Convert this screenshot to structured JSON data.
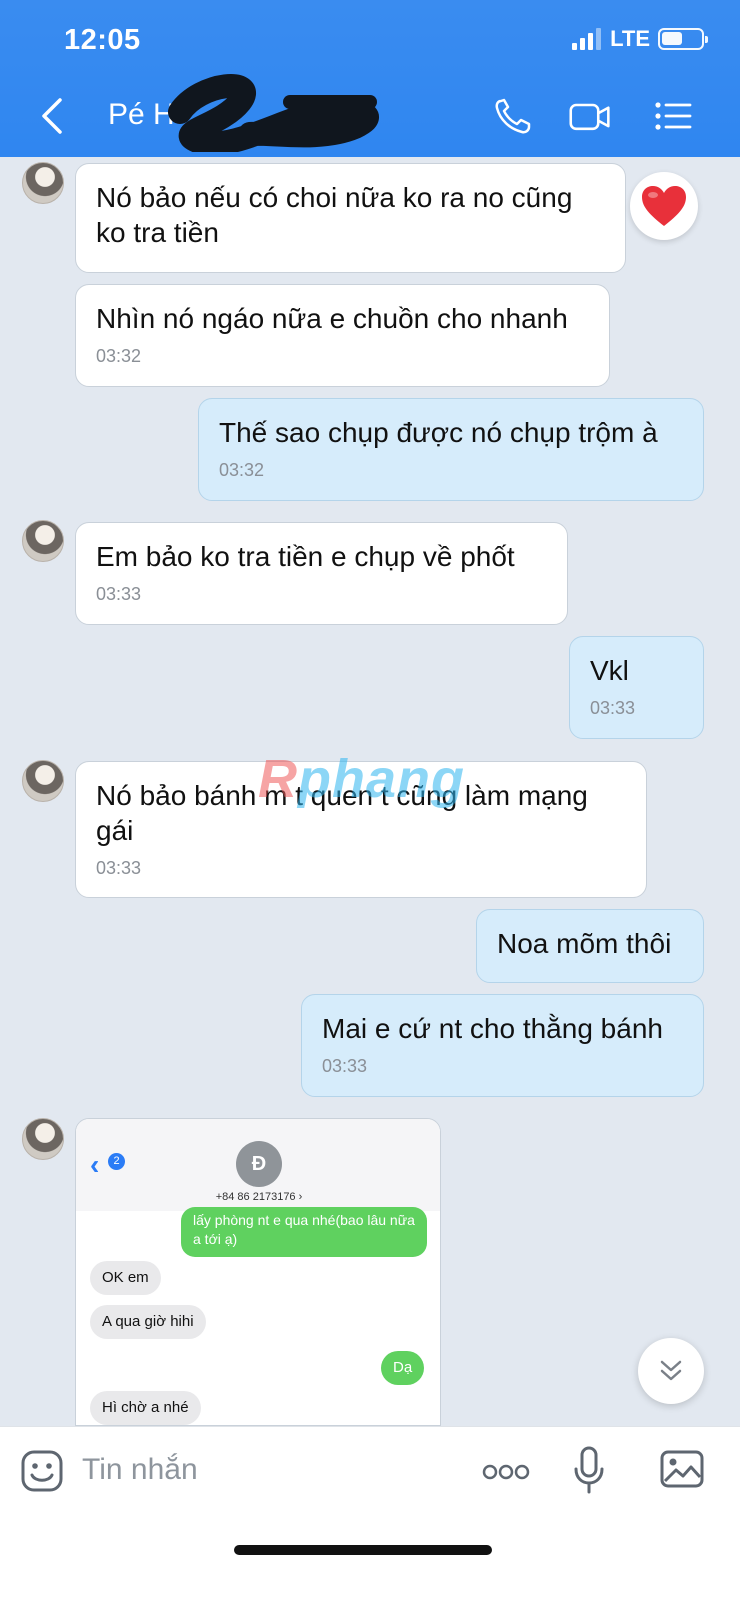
{
  "status_bar": {
    "time": "12:05",
    "network": "LTE"
  },
  "header": {
    "contact_name": "Pé H",
    "redacted": true
  },
  "messages": [
    {
      "dir": "in",
      "text": "Nó bảo nếu có choi nữa ko ra no cũng ko tra tiền",
      "time": "",
      "reaction": "heart"
    },
    {
      "dir": "in",
      "text": "Nhìn nó ngáo nữa e chuồn cho nhanh",
      "time": "03:32"
    },
    {
      "dir": "out",
      "text": "Thế sao chụp được nó chụp trộm à",
      "time": "03:32"
    },
    {
      "dir": "in",
      "text": "Em bảo ko tra tiền e chụp về phốt",
      "time": "03:33"
    },
    {
      "dir": "out",
      "text": "Vkl",
      "time": "03:33"
    },
    {
      "dir": "in",
      "text": "Nó bảo bánh m t quen t cũng làm mạng gái",
      "time": "03:33"
    },
    {
      "dir": "out",
      "text": "Noa mõm thôi",
      "time": ""
    },
    {
      "dir": "out",
      "text": "Mai e cứ nt cho thằng bánh",
      "time": "03:33"
    }
  ],
  "watermark": {
    "first": "R",
    "rest": "phang"
  },
  "image_message": {
    "back_badge": "2",
    "contact_initial": "Đ",
    "phone_number": "+84 86 2173176 ›",
    "sms": [
      {
        "dir": "out",
        "text": "lấy phòng nt e qua nhé(bao lâu nữa a tới ạ)"
      },
      {
        "dir": "in",
        "text": "OK em"
      },
      {
        "dir": "in",
        "text": "A qua giờ hihi"
      },
      {
        "dir": "out",
        "text": "Dạ"
      },
      {
        "dir": "in",
        "text": "Hì chờ a nhé"
      }
    ]
  },
  "composer": {
    "placeholder": "Tin nhắn"
  },
  "colors": {
    "header_blue": "#2f86f0",
    "incoming_bubble": "#ffffff",
    "outgoing_bubble": "#d6ecfb",
    "chat_bg": "#e2e8f0",
    "heart": "#e8303a"
  },
  "icons": [
    "back-arrow",
    "phone",
    "video-camera",
    "menu-list",
    "heart",
    "chevron-double-down",
    "emoji",
    "more-dots",
    "microphone",
    "photo"
  ]
}
